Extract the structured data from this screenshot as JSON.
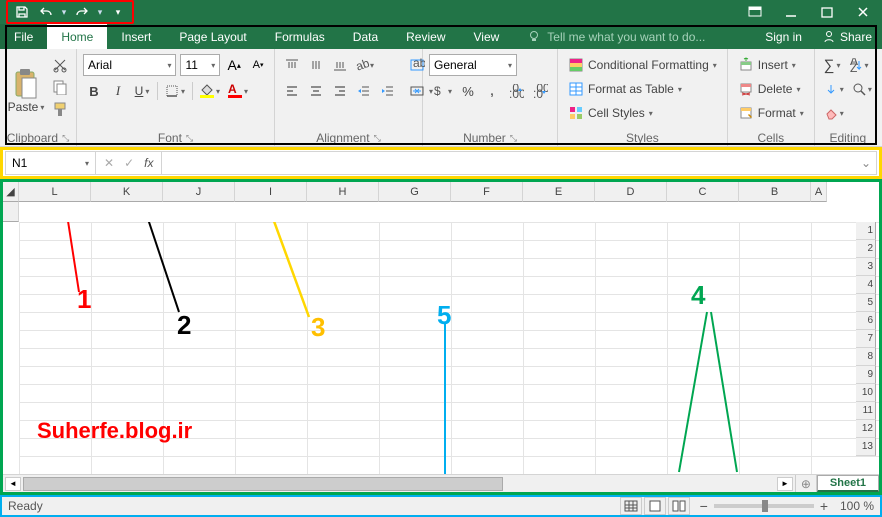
{
  "tabs": {
    "file": "File",
    "home": "Home",
    "insert": "Insert",
    "pagelayout": "Page Layout",
    "formulas": "Formulas",
    "data": "Data",
    "review": "Review",
    "view": "View",
    "tell": "Tell me what you want to do...",
    "signin": "Sign in",
    "share": "Share"
  },
  "ribbon": {
    "clipboard": {
      "label": "Clipboard",
      "paste": "Paste"
    },
    "font": {
      "label": "Font",
      "name": "Arial",
      "size": "11"
    },
    "alignment": {
      "label": "Alignment"
    },
    "number": {
      "label": "Number",
      "format": "General"
    },
    "styles": {
      "label": "Styles",
      "conditional": "Conditional Formatting",
      "table": "Format as Table",
      "cell": "Cell Styles"
    },
    "cells": {
      "label": "Cells",
      "insert": "Insert",
      "delete": "Delete",
      "format": "Format"
    },
    "editing": {
      "label": "Editing"
    }
  },
  "formula_bar": {
    "cell_ref": "N1",
    "formula": ""
  },
  "columns": [
    "L",
    "K",
    "J",
    "I",
    "H",
    "G",
    "F",
    "E",
    "D",
    "C",
    "B",
    "A"
  ],
  "rows": [
    "1",
    "2",
    "3",
    "4",
    "5",
    "6",
    "7",
    "8",
    "9",
    "10",
    "11",
    "12",
    "13"
  ],
  "sheet": {
    "name": "Sheet1"
  },
  "status": {
    "ready": "Ready",
    "zoom": "100 %"
  },
  "watermark": "Suherfe.blog.ir",
  "annotations": {
    "n1": "1",
    "n2": "2",
    "n3": "3",
    "n4": "4",
    "n5": "5"
  }
}
